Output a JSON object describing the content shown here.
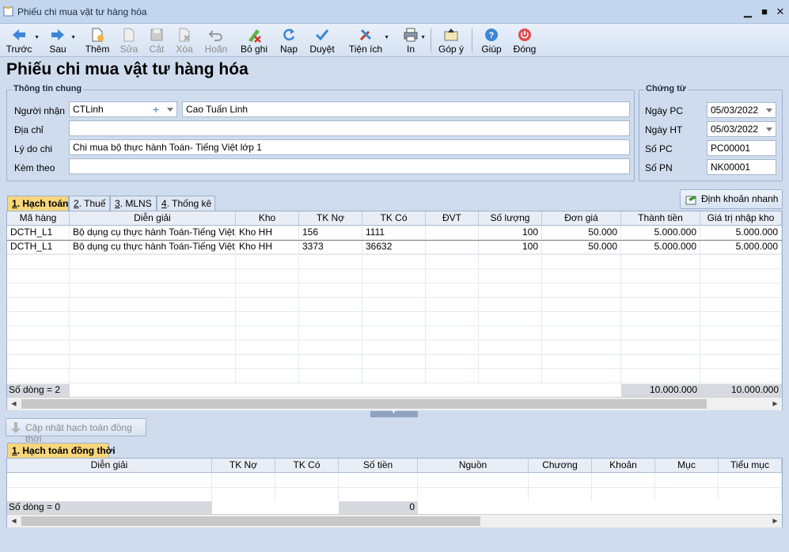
{
  "window": {
    "title": "Phiếu chi mua vật tư hàng hóa",
    "minimize": "▁",
    "maximize": "■",
    "close": "✕"
  },
  "toolbar": {
    "prev": "Trước",
    "next": "Sau",
    "add": "Thêm",
    "edit": "Sửa",
    "cut": "Cắt",
    "delete": "Xóa",
    "undo": "Hoãn",
    "unpost": "Bỏ ghi",
    "reload": "Nạp",
    "approve": "Duyệt",
    "utilities": "Tiện ích",
    "print": "In",
    "feedback": "Góp ý",
    "help": "Giúp",
    "close": "Đóng"
  },
  "heading": "Phiếu chi mua vật tư hàng hóa",
  "general": {
    "title": "Thông tin chung",
    "recipient_label": "Người nhận",
    "recipient_code": "CTLinh",
    "recipient_name": "Cao Tuấn Linh",
    "address_label": "Địa chỉ",
    "address": "",
    "reason_label": "Lý do chi",
    "reason": "Chi mua bộ thực hành Toán- Tiếng Việt lớp 1",
    "attach_label": "Kèm theo",
    "attach": ""
  },
  "voucher": {
    "title": "Chứng từ",
    "pc_date_label": "Ngày PC",
    "pc_date": "05/03/2022",
    "ht_date_label": "Ngày HT",
    "ht_date": "05/03/2022",
    "pc_no_label": "Số PC",
    "pc_no": "PC00001",
    "pn_no_label": "Số PN",
    "pn_no": "NK00001"
  },
  "tabs": [
    {
      "key": "1",
      "label": ". Hạch toán"
    },
    {
      "key": "2",
      "label": ". Thuế"
    },
    {
      "key": "3",
      "label": ". MLNS"
    },
    {
      "key": "4",
      "label": ". Thống kê"
    }
  ],
  "quick_entry": "Định khoản nhanh",
  "main_grid": {
    "headers": [
      "Mã hàng",
      "Diễn giải",
      "Kho",
      "TK Nợ",
      "TK Có",
      "ĐVT",
      "Số lượng",
      "Đơn giá",
      "Thành tiền",
      "Giá trị nhập kho"
    ],
    "rows": [
      [
        "DCTH_L1",
        "Bộ dụng cụ thực hành Toán-Tiếng Việt...",
        "Kho HH",
        "156",
        "1111",
        "",
        "100",
        "50.000",
        "5.000.000",
        "5.000.000"
      ],
      [
        "DCTH_L1",
        "Bộ dụng cụ thực hành Toán-Tiếng Việt...",
        "Kho HH",
        "3373",
        "36632",
        "",
        "100",
        "50.000",
        "5.000.000",
        "5.000.000"
      ]
    ],
    "row_count": "Số dòng = 2",
    "total_amount": "10.000.000",
    "total_stock": "10.000.000"
  },
  "update_button": "Cập nhật hạch toán đồng thời",
  "second_tab": {
    "key": "1",
    "label": ". Hạch toán đồng thời"
  },
  "second_grid": {
    "headers": [
      "Diễn giải",
      "TK Nợ",
      "TK Có",
      "Số tiền",
      "Nguồn",
      "Chương",
      "Khoản",
      "Mục",
      "Tiểu mục"
    ],
    "row_count": "Số dòng = 0",
    "total": "0"
  }
}
